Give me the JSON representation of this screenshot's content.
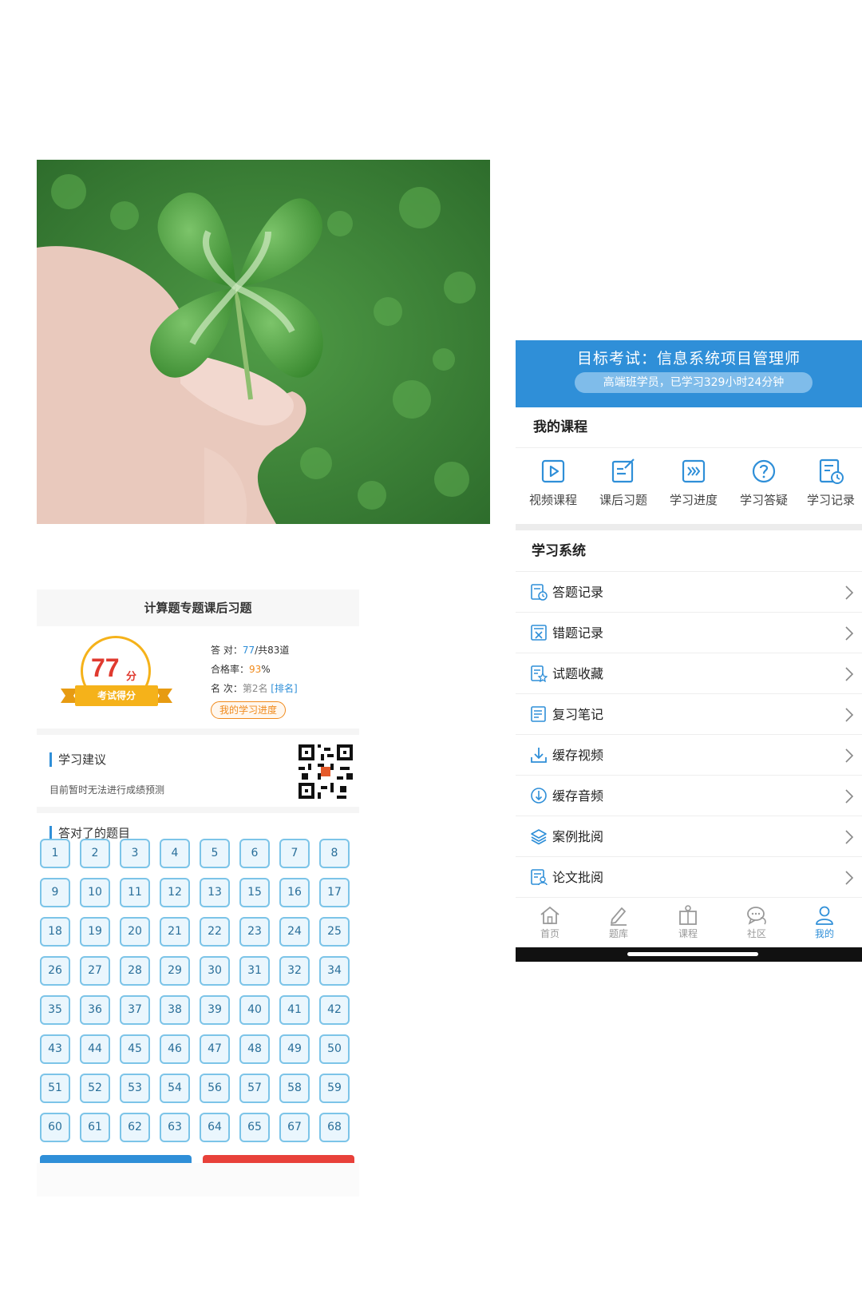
{
  "result": {
    "title": "计算题专题课后习题",
    "score": "77",
    "score_unit": "分",
    "score_caption": "考试得分",
    "correct_label": "答  对：",
    "correct_value": "77",
    "correct_total": "/共83道",
    "pass_rate_label": "合格率：",
    "pass_rate_value": "93",
    "pass_rate_unit": "%",
    "rank_label": "名  次：",
    "rank_value": "第2名",
    "rank_link": "[排名]",
    "progress_button": "我的学习进度",
    "advice_title": "学习建议",
    "advice_text": "目前暂时无法进行成绩预测",
    "correct_title": "答对了的题目",
    "questions": [
      "1",
      "2",
      "3",
      "4",
      "5",
      "6",
      "7",
      "8",
      "9",
      "10",
      "11",
      "12",
      "13",
      "15",
      "16",
      "17",
      "18",
      "19",
      "20",
      "21",
      "22",
      "23",
      "24",
      "25",
      "26",
      "27",
      "28",
      "29",
      "30",
      "31",
      "32",
      "34",
      "35",
      "36",
      "37",
      "38",
      "39",
      "40",
      "41",
      "42",
      "43",
      "44",
      "45",
      "46",
      "47",
      "48",
      "49",
      "50",
      "51",
      "52",
      "53",
      "54",
      "56",
      "57",
      "58",
      "59",
      "60",
      "61",
      "62",
      "63",
      "64",
      "65",
      "67",
      "68"
    ]
  },
  "profile": {
    "target_title": "目标考试：信息系统项目管理师",
    "target_sub": "高端班学员，已学习329小时24分钟",
    "my_course_title": "我的课程",
    "courses": [
      {
        "label": "视频课程",
        "icon": "video-play-icon"
      },
      {
        "label": "课后习题",
        "icon": "exercise-edit-icon"
      },
      {
        "label": "学习进度",
        "icon": "progress-forward-icon"
      },
      {
        "label": "学习答疑",
        "icon": "question-icon"
      },
      {
        "label": "学习记录",
        "icon": "record-clock-icon"
      }
    ],
    "system_title": "学习系统",
    "menu": [
      {
        "label": "答题记录",
        "icon": "answer-record-icon"
      },
      {
        "label": "错题记录",
        "icon": "wrong-record-icon"
      },
      {
        "label": "试题收藏",
        "icon": "favorite-questions-icon"
      },
      {
        "label": "复习笔记",
        "icon": "review-notes-icon"
      },
      {
        "label": "缓存视频",
        "icon": "download-icon"
      },
      {
        "label": "缓存音频",
        "icon": "audio-download-icon"
      },
      {
        "label": "案例批阅",
        "icon": "layers-icon"
      },
      {
        "label": "论文批阅",
        "icon": "paper-review-icon"
      }
    ],
    "tabs": [
      {
        "label": "首页",
        "icon": "home-icon"
      },
      {
        "label": "题库",
        "icon": "pen-icon"
      },
      {
        "label": "课程",
        "icon": "course-book-icon"
      },
      {
        "label": "社区",
        "icon": "chat-icon"
      },
      {
        "label": "我的",
        "icon": "user-icon"
      }
    ]
  },
  "colors": {
    "primary_blue": "#2f8fd8",
    "score_red": "#e03a2f",
    "accent_orange": "#f08a1c",
    "cell_border": "#7cc4e8"
  }
}
